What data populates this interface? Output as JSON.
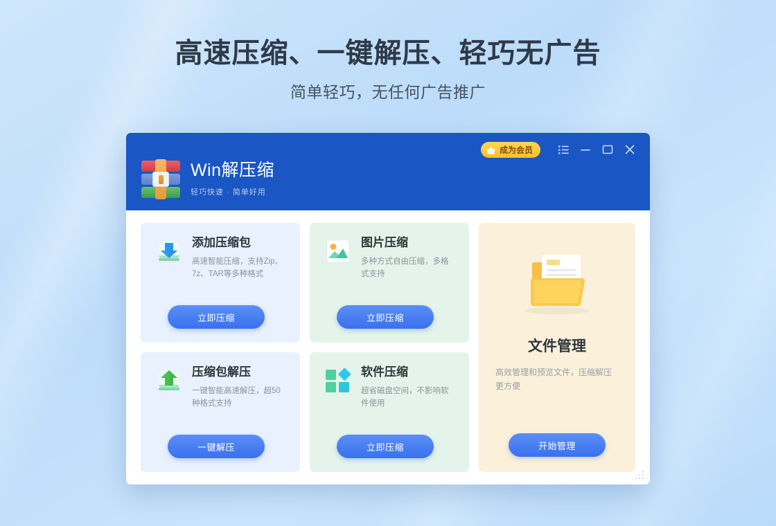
{
  "hero": {
    "title": "高速压缩、一键解压、轻巧无广告",
    "subtitle": "简单轻巧，无任何广告推广"
  },
  "window": {
    "brand_name": "Win解压缩",
    "brand_slogan": "轻巧快速 · 简单好用",
    "logo_icon": "winrar-books-icon",
    "vip_badge": {
      "label": "成为会员",
      "icon": "crown-icon",
      "bg_color": "#fcc42c",
      "text_color": "#8a4b14"
    },
    "controls": [
      {
        "name": "menu-button",
        "icon": "list-menu-icon"
      },
      {
        "name": "minimize-button",
        "icon": "minimize-icon"
      },
      {
        "name": "maximize-button",
        "icon": "maximize-icon"
      },
      {
        "name": "close-button",
        "icon": "close-icon"
      }
    ],
    "titlebar_color": "#1a56c4",
    "resize_grip": "resize-grip-icon"
  },
  "cards": [
    {
      "id": "add-archive",
      "title": "添加压缩包",
      "desc": "高速智能压缩，支持Zip、7z、TAR等多种格式",
      "button": "立即压缩",
      "icon": "archive-download-icon",
      "bg_color": "#e8f1fd"
    },
    {
      "id": "image-compress",
      "title": "图片压缩",
      "desc": "多种方式自由压缩，多格式支持",
      "button": "立即压缩",
      "icon": "picture-icon",
      "bg_color": "#e4f4ea"
    },
    {
      "id": "extract-archive",
      "title": "压缩包解压",
      "desc": "一键智能高速解压，超50种格式支持",
      "button": "一键解压",
      "icon": "archive-upload-icon",
      "bg_color": "#e8f1fd"
    },
    {
      "id": "software-compress",
      "title": "软件压缩",
      "desc": "超省磁盘空间，不影响软件使用",
      "button": "立即压缩",
      "icon": "squares-diamond-icon",
      "bg_color": "#e4f4ea"
    }
  ],
  "panel": {
    "id": "file-management",
    "title": "文件管理",
    "desc": "高效管理和预览文件，压缩解压更方便",
    "button": "开始管理",
    "icon": "folder-document-icon",
    "bg_color": "#fbf0da"
  },
  "theme": {
    "accent": "#3a71ee",
    "background": "#bcdcfa"
  }
}
